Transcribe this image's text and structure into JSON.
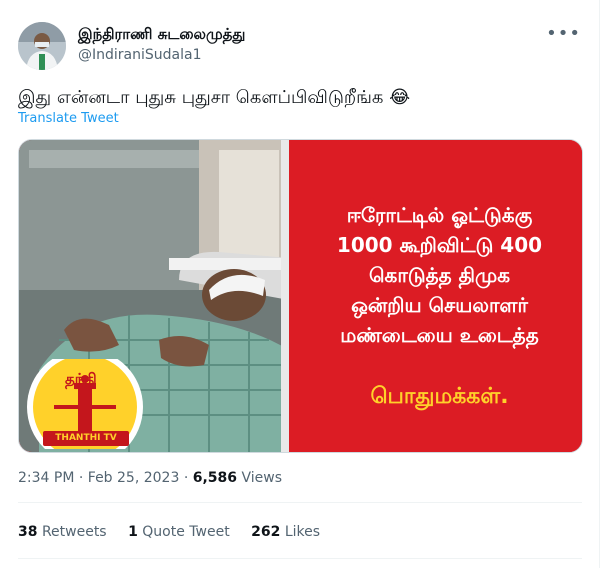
{
  "author": {
    "display_name": "இந்திராணி சுடலைமுத்து",
    "handle": "@IndiraniSudala1"
  },
  "more_icon": "more-horizontal-icon",
  "tweet": {
    "text": "இது என்னடா புதுசு புதுசா கௌப்பிவிடுறீங்க 😂",
    "translate_label": "Translate Tweet"
  },
  "media": {
    "headline_lines": [
      "ஈரோட்டில் ஓட்டுக்கு",
      "1000 கூறிவிட்டு 400",
      "கொடுத்த திமுக",
      "ஒன்றிய செயலாளர்",
      "மண்டையை உடைத்த"
    ],
    "headline_last": "பொதுமக்கள்.",
    "channel_logo_title": "தந்தி",
    "channel_logo_sub": "THANTHI TV",
    "panel_color": "#dc1c24"
  },
  "meta": {
    "time": "2:34 PM",
    "separator": "·",
    "date": "Feb 25, 2023",
    "views_count": "6,586",
    "views_label": "Views"
  },
  "stats": {
    "retweets_count": "38",
    "retweets_label": "Retweets",
    "quotes_count": "1",
    "quotes_label": "Quote Tweet",
    "likes_count": "262",
    "likes_label": "Likes"
  },
  "colors": {
    "link": "#1d9bf0",
    "muted": "#536471",
    "text": "#0f1419"
  }
}
